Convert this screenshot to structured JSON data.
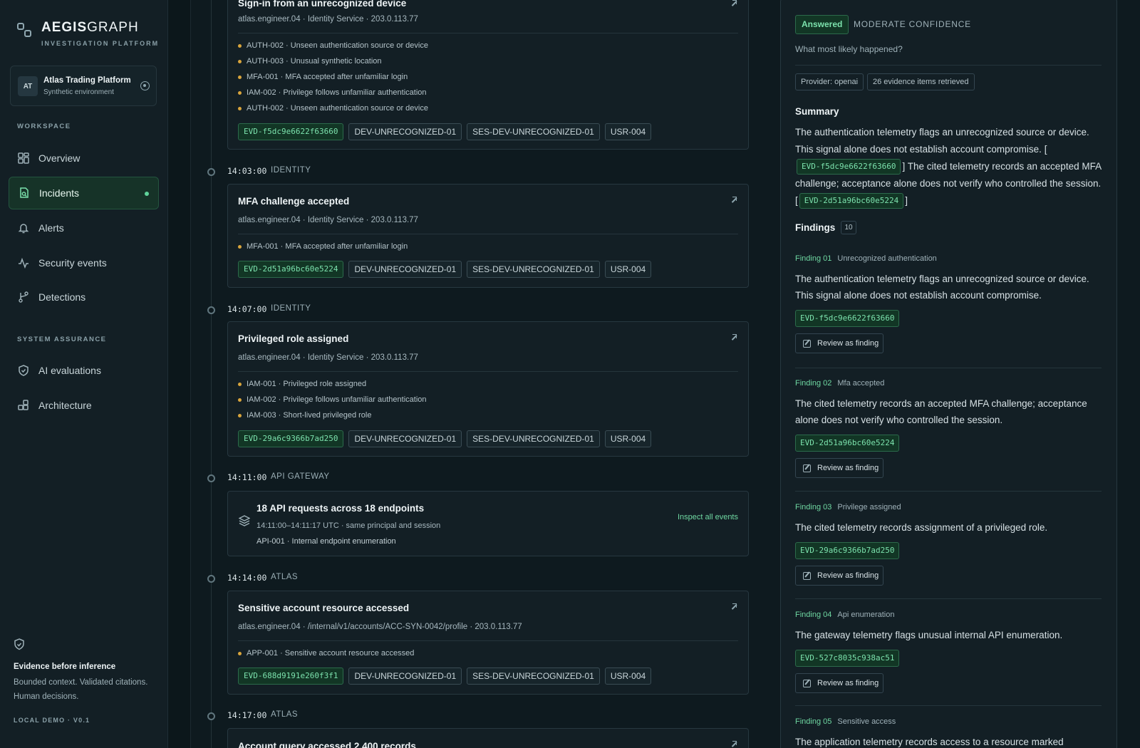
{
  "brand": {
    "name_bold": "AEGIS",
    "name_light": "GRAPH",
    "subtitle": "INVESTIGATION PLATFORM"
  },
  "org": {
    "initials": "AT",
    "name": "Atlas Trading Platform",
    "environment": "Synthetic environment"
  },
  "nav": {
    "workspace_label": "WORKSPACE",
    "workspace_items": [
      {
        "label": "Overview",
        "icon": "grid-icon"
      },
      {
        "label": "Incidents",
        "icon": "document-search-icon",
        "active": true
      },
      {
        "label": "Alerts",
        "icon": "bell-icon"
      },
      {
        "label": "Security events",
        "icon": "pulse-icon"
      },
      {
        "label": "Detections",
        "icon": "branch-icon"
      }
    ],
    "assurance_label": "SYSTEM ASSURANCE",
    "assurance_items": [
      {
        "label": "AI evaluations",
        "icon": "shield-check-icon"
      },
      {
        "label": "Architecture",
        "icon": "blocks-icon"
      }
    ]
  },
  "footer": {
    "title": "Evidence before inference",
    "description": "Bounded context. Validated citations. Human decisions.",
    "version": "LOCAL DEMO · V0.1"
  },
  "timeline": {
    "top_card": {
      "title": "Sign-in from an unrecognized device",
      "meta": "atlas.engineer.04 · Identity Service · 203.0.113.77",
      "signals": [
        "AUTH-002 · Unseen authentication source or device",
        "AUTH-003 · Unusual synthetic location",
        "MFA-001 · MFA accepted after unfamiliar login",
        "IAM-002 · Privilege follows unfamiliar authentication",
        "AUTH-002 · Unseen authentication source or device"
      ],
      "tags": [
        "EVD-f5dc9e6622f63660",
        "DEV-UNRECOGNIZED-01",
        "SES-DEV-UNRECOGNIZED-01",
        "USR-004"
      ]
    },
    "events": [
      {
        "time": "14:03:00",
        "category": "IDENTITY",
        "title": "MFA challenge accepted",
        "meta": "atlas.engineer.04 · Identity Service · 203.0.113.77",
        "signals": [
          "MFA-001 · MFA accepted after unfamiliar login"
        ],
        "tags": [
          "EVD-2d51a96bc60e5224",
          "DEV-UNRECOGNIZED-01",
          "SES-DEV-UNRECOGNIZED-01",
          "USR-004"
        ]
      },
      {
        "time": "14:07:00",
        "category": "IDENTITY",
        "title": "Privileged role assigned",
        "meta": "atlas.engineer.04 · Identity Service · 203.0.113.77",
        "signals": [
          "IAM-001 · Privileged role assigned",
          "IAM-002 · Privilege follows unfamiliar authentication",
          "IAM-003 · Short-lived privileged role"
        ],
        "tags": [
          "EVD-29a6c9366b7ad250",
          "DEV-UNRECOGNIZED-01",
          "SES-DEV-UNRECOGNIZED-01",
          "USR-004"
        ]
      },
      {
        "time": "14:11:00",
        "category": "API GATEWAY",
        "title": "18 API requests across 18 endpoints",
        "range": "14:11:00–14:11:17 UTC · same principal and session",
        "rule": "API-001 · Internal endpoint enumeration",
        "action": "Inspect all events"
      },
      {
        "time": "14:14:00",
        "category": "ATLAS",
        "title": "Sensitive account resource accessed",
        "meta": "atlas.engineer.04 · /internal/v1/accounts/ACC-SYN-0042/profile · 203.0.113.77",
        "signals": [
          "APP-001 · Sensitive account resource accessed"
        ],
        "tags": [
          "EVD-688d9191e260f3f1",
          "DEV-UNRECOGNIZED-01",
          "SES-DEV-UNRECOGNIZED-01",
          "USR-004"
        ]
      },
      {
        "time": "14:17:00",
        "category": "ATLAS",
        "title": "Account query accessed 2,400 records"
      }
    ]
  },
  "panel": {
    "status": "Answered",
    "confidence": "MODERATE CONFIDENCE",
    "question": "What most likely happened?",
    "provider": "Provider: openai",
    "evidence_count": "26 evidence items retrieved",
    "summary_heading": "Summary",
    "summary": {
      "part1": "The authentication telemetry flags an unrecognized source or device. This signal alone does not establish account compromise. [",
      "cite1": "EVD-f5dc9e6622f63660",
      "part2": "] The cited telemetry records an accepted MFA challenge; acceptance alone does not verify who controlled the session. [",
      "cite2": "EVD-2d51a96bc60e5224",
      "part3": "]"
    },
    "findings_heading": "Findings",
    "findings_count": "10",
    "review_label": "Review as finding",
    "findings": [
      {
        "num": "Finding 01",
        "label": "Unrecognized authentication",
        "text": "The authentication telemetry flags an unrecognized source or device. This signal alone does not establish account compromise.",
        "evidence": "EVD-f5dc9e6622f63660"
      },
      {
        "num": "Finding 02",
        "label": "Mfa accepted",
        "text": "The cited telemetry records an accepted MFA challenge; acceptance alone does not verify who controlled the session.",
        "evidence": "EVD-2d51a96bc60e5224"
      },
      {
        "num": "Finding 03",
        "label": "Privilege assigned",
        "text": "The cited telemetry records assignment of a privileged role.",
        "evidence": "EVD-29a6c9366b7ad250"
      },
      {
        "num": "Finding 04",
        "label": "Api enumeration",
        "text": "The gateway telemetry flags unusual internal API enumeration.",
        "evidence": "EVD-527c8035c938ac51"
      },
      {
        "num": "Finding 05",
        "label": "Sensitive access",
        "text": "The application telemetry records access to a resource marked"
      }
    ]
  }
}
